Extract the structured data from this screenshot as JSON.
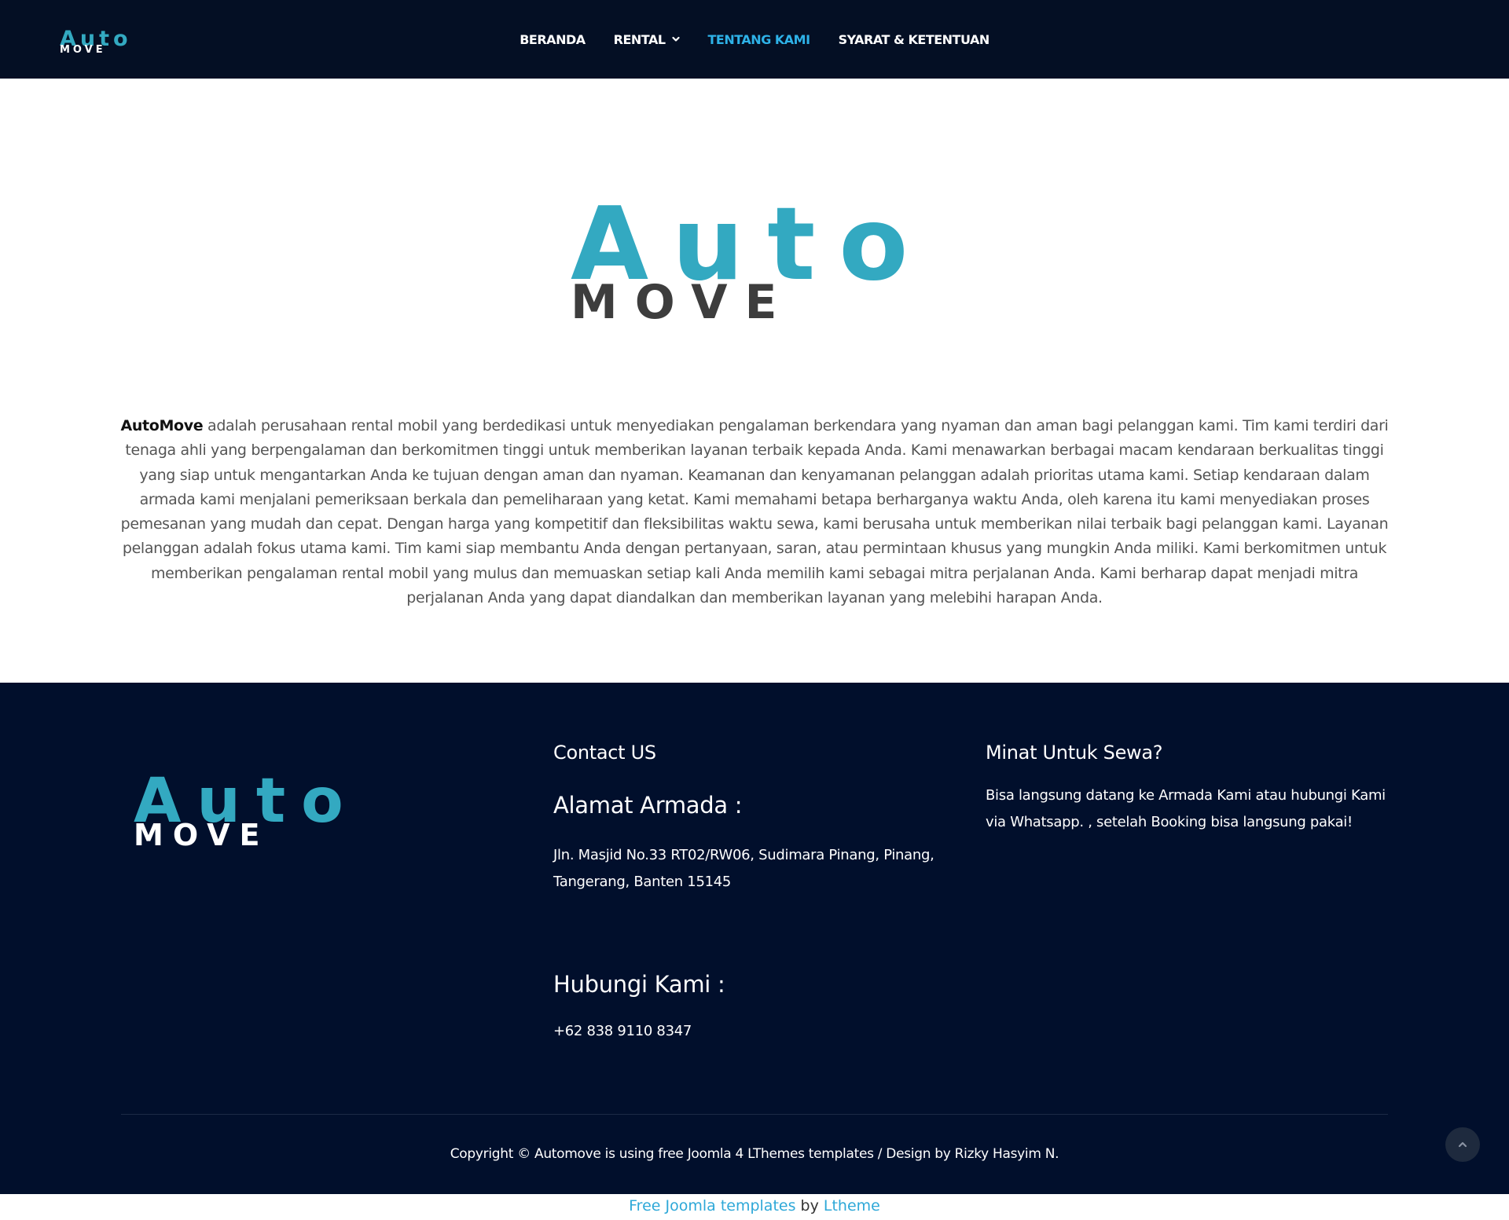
{
  "brand": {
    "logo_top": "Auto",
    "logo_bottom": "MOVE",
    "accent_color": "#33a9c1",
    "dark_color": "#3d3d3d"
  },
  "nav": {
    "items": [
      {
        "label": "BERANDA",
        "active": false,
        "dropdown": false
      },
      {
        "label": "RENTAL",
        "active": false,
        "dropdown": true,
        "icon": "chevron-down-icon"
      },
      {
        "label": "TENTANG KAMI",
        "active": true,
        "dropdown": false
      },
      {
        "label": "SYARAT & KETENTUAN",
        "active": false,
        "dropdown": false
      }
    ]
  },
  "about": {
    "company": "AutoMove",
    "text": " adalah perusahaan rental mobil yang berdedikasi untuk menyediakan pengalaman berkendara yang nyaman dan aman bagi pelanggan kami. Tim kami terdiri dari tenaga ahli yang berpengalaman dan berkomitmen tinggi untuk memberikan layanan terbaik kepada Anda. Kami menawarkan berbagai macam kendaraan berkualitas tinggi yang siap untuk mengantarkan Anda ke tujuan dengan aman dan nyaman. Keamanan dan kenyamanan pelanggan adalah prioritas utama kami. Setiap kendaraan dalam armada kami menjalani pemeriksaan berkala dan pemeliharaan yang ketat. Kami memahami betapa berharganya waktu Anda, oleh karena itu kami menyediakan proses pemesanan yang mudah dan cepat. Dengan harga yang kompetitif dan fleksibilitas waktu sewa, kami berusaha untuk memberikan nilai terbaik bagi pelanggan kami. Layanan pelanggan adalah fokus utama kami. Tim kami siap membantu Anda dengan pertanyaan, saran, atau permintaan khusus yang mungkin Anda miliki. Kami berkomitmen untuk memberikan pengalaman rental mobil yang mulus dan memuaskan setiap kali Anda memilih kami sebagai mitra perjalanan Anda. Kami berharap dapat menjadi mitra perjalanan Anda yang dapat diandalkan dan memberikan layanan yang melebihi harapan Anda."
  },
  "footer": {
    "contact_title": "Contact US",
    "address_heading": "Alamat Armada :",
    "address": "Jln. Masjid No.33 RT02/RW06, Sudimara Pinang, Pinang, Tangerang, Banten 15145",
    "phone_heading": "Hubungi Kami :",
    "phone": "+62 838 9110 8347",
    "rent_title": "Minat Untuk Sewa?",
    "rent_text": "Bisa langsung datang ke Armada Kami atau hubungi Kami via Whatsapp. , setelah Booking bisa langsung pakai!",
    "copyright": "Copyright © Automove is using free Joomla 4 LThemes templates / Design by Rizky Hasyim N.",
    "back_to_top_icon": "chevron-up-icon"
  },
  "credits": {
    "link1": "Free Joomla templates",
    "by": " by ",
    "link2": "Ltheme"
  }
}
